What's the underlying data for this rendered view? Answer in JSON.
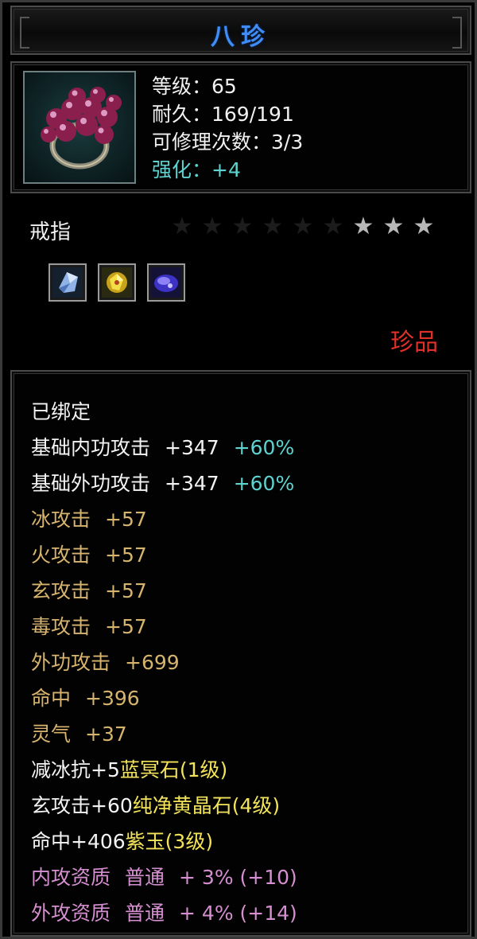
{
  "title": "八珍",
  "stats": {
    "level": "等级：65",
    "durability": "耐久：169/191",
    "repairs": "可修理次数：3/3",
    "enhance": "强化：+4"
  },
  "item_type": "戒指",
  "stars": {
    "total": 9,
    "lit": 3
  },
  "gems": [
    {
      "name": "blue-crystal-gem-icon"
    },
    {
      "name": "yellow-crystal-gem-icon"
    },
    {
      "name": "purple-jade-gem-icon"
    }
  ],
  "rarity": "珍品",
  "attributes": {
    "bound": "已绑定",
    "base_inner": {
      "label": "基础内功攻击",
      "value": "+347",
      "bonus": "+60%"
    },
    "base_outer": {
      "label": "基础外功攻击",
      "value": "+347",
      "bonus": "+60%"
    },
    "ice_attack": {
      "label": "冰攻击",
      "value": "+57"
    },
    "fire_attack": {
      "label": "火攻击",
      "value": "+57"
    },
    "mystic_attack": {
      "label": "玄攻击",
      "value": "+57"
    },
    "poison_attack": {
      "label": "毒攻击",
      "value": "+57"
    },
    "outer_attack": {
      "label": "外功攻击",
      "value": "+699"
    },
    "hit": {
      "label": "命中",
      "value": "+396"
    },
    "spirit": {
      "label": "灵气",
      "value": "+37"
    },
    "gem1": {
      "effect": "减冰抗+5",
      "gem": "蓝冥石(1级)"
    },
    "gem2": {
      "effect": "玄攻击+60",
      "gem": "纯净黄晶石(4级)"
    },
    "gem3": {
      "effect": "命中+406",
      "gem": "紫玉(3级)"
    },
    "quality_inner": {
      "label": "内攻资质",
      "grade": "普通",
      "value": "+ 3% (+10)"
    },
    "quality_outer": {
      "label": "外攻资质",
      "grade": "普通",
      "value": "+ 4% (+14)"
    }
  },
  "colors": {
    "title": "#3f8df5",
    "enhance": "#5ed3cf",
    "gold": "#d7b46e",
    "rarity": "#e0302a",
    "gem_name": "#f2e35a",
    "quality": "#d58fd0"
  }
}
